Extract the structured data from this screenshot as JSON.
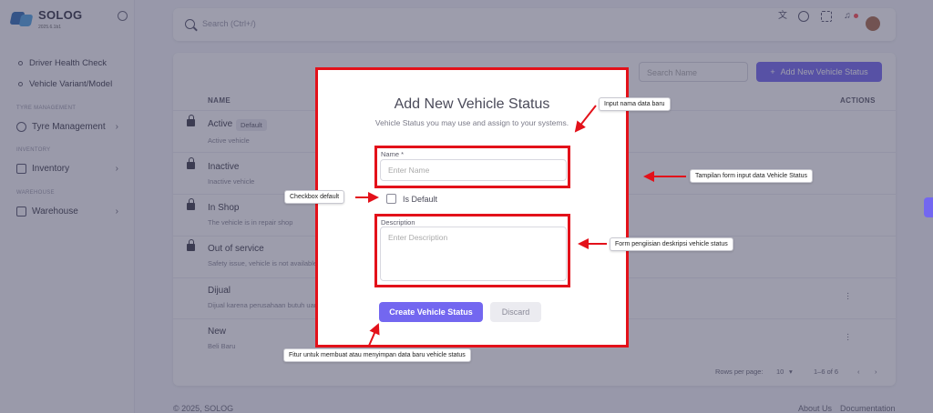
{
  "app": {
    "name": "SOLOG",
    "version": "2025.6.1b1"
  },
  "sidebar": {
    "items": [
      {
        "label": "Driver Health Check"
      },
      {
        "label": "Vehicle Variant/Model"
      }
    ],
    "sections": [
      {
        "header": "TYRE MANAGEMENT",
        "label": "Tyre Management"
      },
      {
        "header": "INVENTORY",
        "label": "Inventory"
      },
      {
        "header": "WAREHOUSE",
        "label": "Warehouse"
      }
    ]
  },
  "topbar": {
    "search_placeholder": "Search (Ctrl+/)"
  },
  "list": {
    "search_placeholder": "Search Name",
    "add_button": "Add New Vehicle Status",
    "col_name": "NAME",
    "col_actions": "ACTIONS",
    "rows": [
      {
        "title": "Active",
        "badge": "Default",
        "desc": "Active vehicle"
      },
      {
        "title": "Inactive",
        "desc": "Inactive vehicle"
      },
      {
        "title": "In Shop",
        "desc": "The vehicle is in repair shop"
      },
      {
        "title": "Out of service",
        "desc": "Safety issue, vehicle is not available"
      },
      {
        "title": "Dijual",
        "desc": "Dijual karena perusahaan butuh uang"
      },
      {
        "title": "New",
        "desc": "Beli Baru"
      }
    ],
    "rows_per_page_label": "Rows per page:",
    "rows_per_page": "10",
    "range": "1–6 of 6"
  },
  "footer": {
    "copyright": "© 2025, SOLOG",
    "links": [
      "About Us",
      "Documentation"
    ]
  },
  "modal": {
    "title": "Add New Vehicle Status",
    "subtitle": "Vehicle Status you may use and assign to your systems.",
    "name_label": "Name *",
    "name_placeholder": "Enter Name",
    "default_label": "Is Default",
    "desc_label": "Description",
    "desc_placeholder": "Enter Description",
    "create_button": "Create Vehicle Status",
    "discard_button": "Discard"
  },
  "callouts": {
    "input_name": "Input nama data baru",
    "form": "Tampilan form input data Vehicle Status",
    "checkbox": "Checkbox default",
    "description": "Form pengiisian deskripsi vehicle status",
    "create": "Fitur untuk membuat atau menyimpan data baru vehicle status"
  },
  "colors": {
    "accent": "#7367f0",
    "annotation_red": "#e3111a"
  },
  "icons": [
    "search-icon",
    "translate-icon",
    "theme-icon",
    "shortcuts-icon",
    "bell-icon",
    "lock-icon",
    "more-vert-icon",
    "plus-icon"
  ]
}
